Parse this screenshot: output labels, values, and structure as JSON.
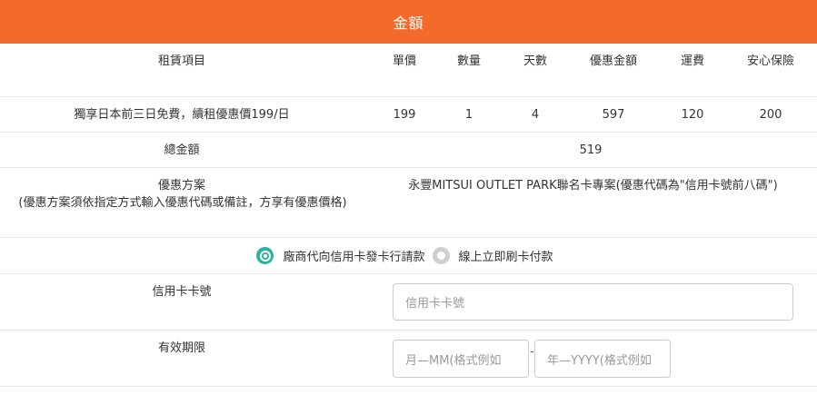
{
  "header": {
    "title": "金額"
  },
  "table": {
    "columns": {
      "item": "租賃項目",
      "unit_price": "單價",
      "quantity": "數量",
      "days": "天數",
      "discount_amount": "優惠金額",
      "shipping": "運費",
      "insurance": "安心保險"
    },
    "row": {
      "item": "獨享日本前三日免費，續租優惠價199/日",
      "unit_price": "199",
      "quantity": "1",
      "days": "4",
      "discount_amount": "597",
      "shipping": "120",
      "insurance": "200"
    },
    "total": {
      "label": "總金額",
      "value": "519"
    },
    "promo": {
      "label": "優惠方案",
      "note": "(優惠方案須依指定方式輸入優惠代碼或備註，方享有優惠價格)",
      "value": "永豐MITSUI OUTLET PARK聯名卡專案(優惠代碼為\"信用卡號前八碼\")"
    }
  },
  "payment": {
    "option_1": "廠商代向信用卡發卡行請款",
    "option_2": "線上立即刷卡付款",
    "selected": "option_1"
  },
  "card": {
    "number_label": "信用卡卡號",
    "number_placeholder": "信用卡卡號",
    "expiry_label": "有效期限",
    "month_placeholder": "月—MM(格式例如",
    "year_placeholder": "年—YYYY(格式例如",
    "separator": "-"
  },
  "colors": {
    "header": "#f26b2a",
    "radio_active": "#2bb3a1"
  }
}
